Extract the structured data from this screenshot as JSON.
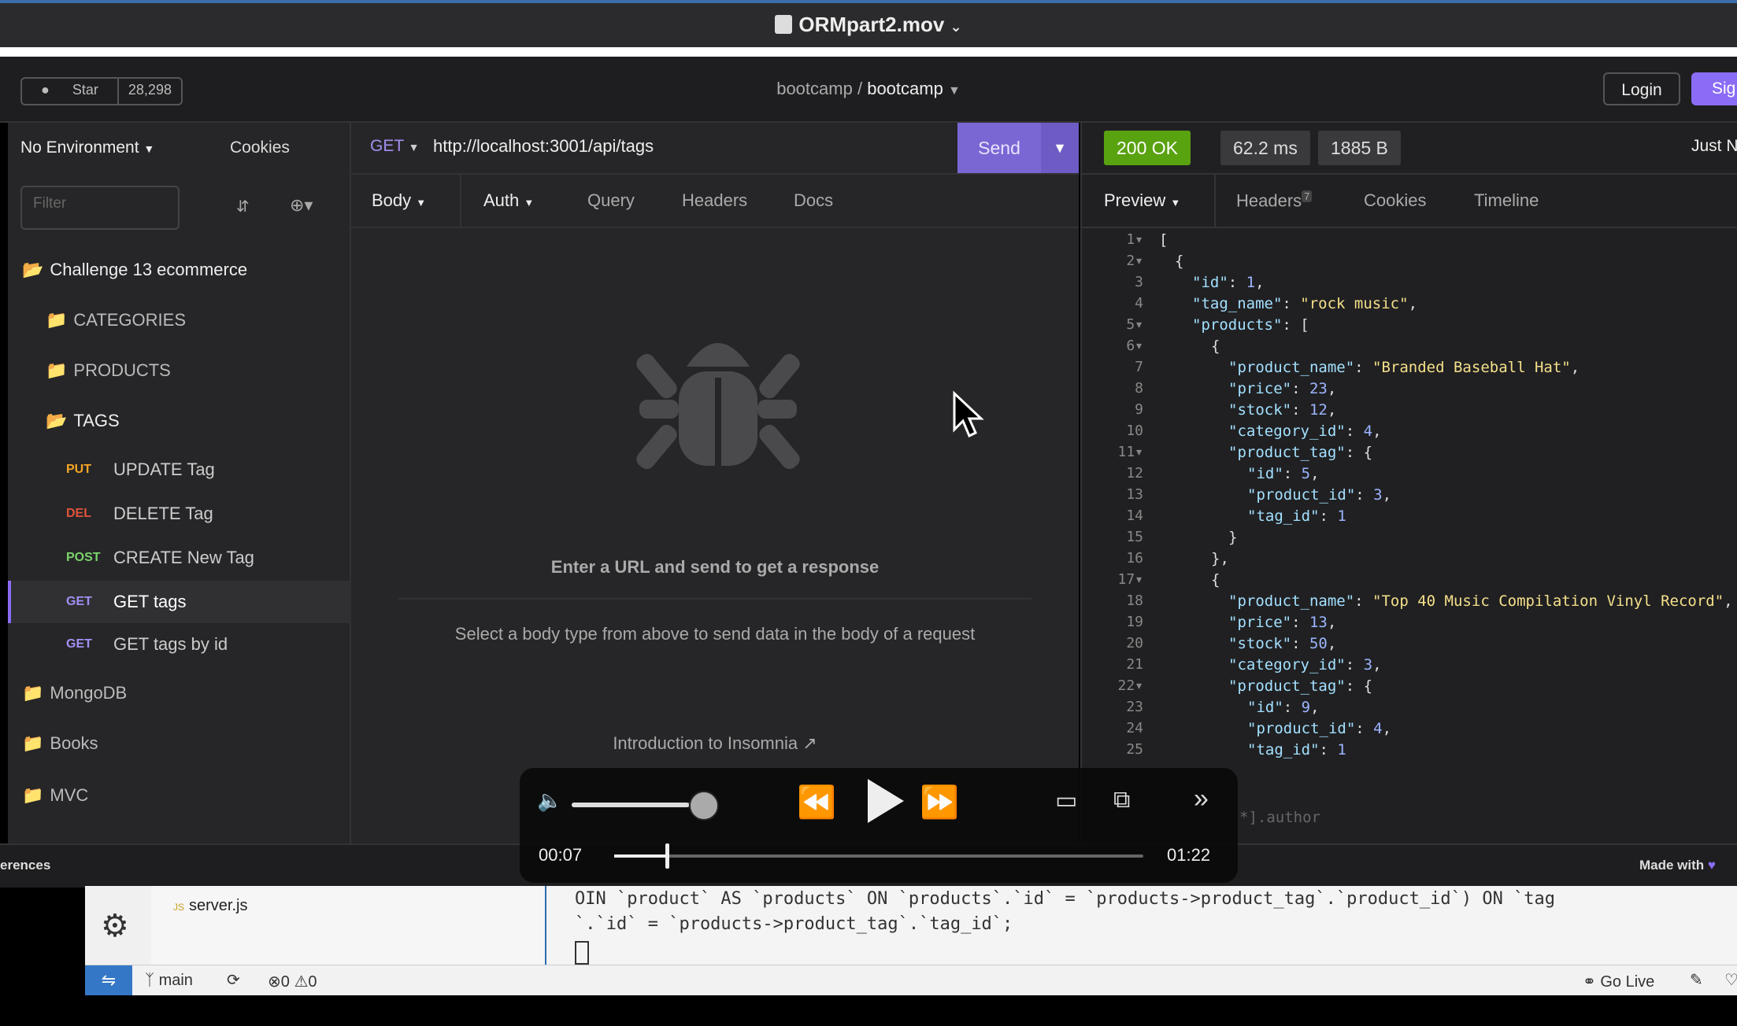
{
  "window": {
    "title": "ORMpart2.mov"
  },
  "header": {
    "star_label": "Star",
    "star_count": "28,298",
    "breadcrumb_org": "bootcamp",
    "breadcrumb_sep": "/",
    "breadcrumb_project": "bootcamp",
    "login_label": "Login",
    "signup_label": "Sig"
  },
  "sidebar": {
    "environment": "No Environment",
    "cookies": "Cookies",
    "filter_placeholder": "Filter",
    "collection": "Challenge 13 ecommerce",
    "folders": [
      "CATEGORIES",
      "PRODUCTS",
      "TAGS"
    ],
    "requests": [
      {
        "method": "PUT",
        "name": "UPDATE Tag",
        "color": "#f5a623"
      },
      {
        "method": "DEL",
        "name": "DELETE Tag",
        "color": "#e0533a"
      },
      {
        "method": "POST",
        "name": "CREATE New Tag",
        "color": "#7bd36b"
      },
      {
        "method": "GET",
        "name": "GET tags",
        "color": "#a48ff3"
      },
      {
        "method": "GET",
        "name": "GET tags by id",
        "color": "#a48ff3"
      }
    ],
    "other_folders": [
      "MongoDB",
      "Books",
      "MVC"
    ]
  },
  "request": {
    "method": "GET",
    "url": "http://localhost:3001/api/tags",
    "send_label": "Send",
    "tabs": [
      "Body",
      "Auth",
      "Query",
      "Headers",
      "Docs"
    ],
    "empty_title": "Enter a URL and send to get a response",
    "empty_desc": "Select a body type from above to send data in the body of a request",
    "intro_link": "Introduction to Insomnia"
  },
  "response": {
    "status": "200 OK",
    "time": "62.2 ms",
    "size": "1885 B",
    "timestamp": "Just N",
    "tabs": [
      "Preview",
      "Headers",
      "Cookies",
      "Timeline"
    ],
    "headers_count": "7",
    "filter_hint": "*].author",
    "status_color": "#59a210"
  },
  "footer": {
    "preferences": "erences",
    "made_with": "Made with"
  },
  "video": {
    "current": "00:07",
    "total": "01:22",
    "progress": 0.1,
    "volume": 0.8
  },
  "vscode": {
    "file": "server.js",
    "file_icon": "JS",
    "sql_line1": "OIN `product` AS `products` ON `products`.`id` = `products->product_tag`.`product_id`) ON `tag",
    "sql_line2": "`.`id` = `products->product_tag`.`tag_id`;",
    "branch": "main",
    "errors": "0",
    "warnings": "0",
    "go_live": "Go Live"
  }
}
